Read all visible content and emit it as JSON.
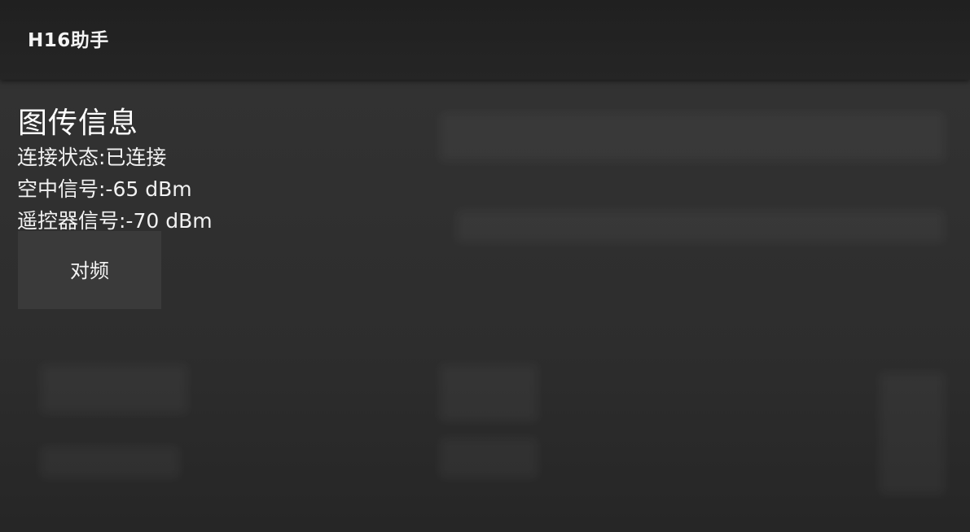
{
  "app_bar": {
    "title": "H16助手"
  },
  "transmission_info": {
    "heading": "图传信息",
    "connection_status": "连接状态:已连接",
    "air_signal": "空中信号:-65 dBm",
    "remote_signal": "遥控器信号:-70 dBm"
  },
  "actions": {
    "pair_label": "对频"
  },
  "colors": {
    "app_bar": "#222222",
    "background": "#2d2d2d",
    "button": "#3a3a3a",
    "text": "#ffffff"
  }
}
